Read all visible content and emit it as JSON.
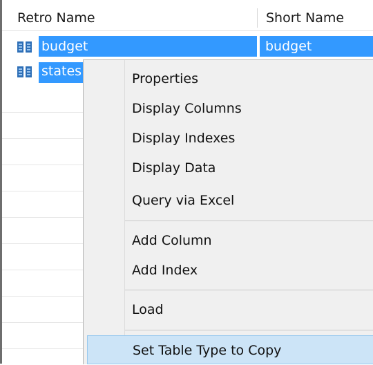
{
  "columns": {
    "retro_name": "Retro Name",
    "short_name": "Short Name"
  },
  "rows": [
    {
      "retro_name": "budget",
      "short_name": "budget",
      "icon": "table-icon"
    },
    {
      "retro_name": "states",
      "short_name": "",
      "icon": "table-icon"
    }
  ],
  "context_menu": {
    "group1": [
      "Properties",
      "Display Columns",
      "Display Indexes",
      "Display Data",
      "Query via Excel"
    ],
    "group2": [
      "Add Column",
      "Add Index"
    ],
    "group3": [
      "Load"
    ],
    "group4": [
      "Set Table Type to Copy"
    ]
  },
  "colors": {
    "selection": "#3399ff",
    "menu_highlight": "#cce4f7",
    "menu_background": "#f0f0f0"
  }
}
